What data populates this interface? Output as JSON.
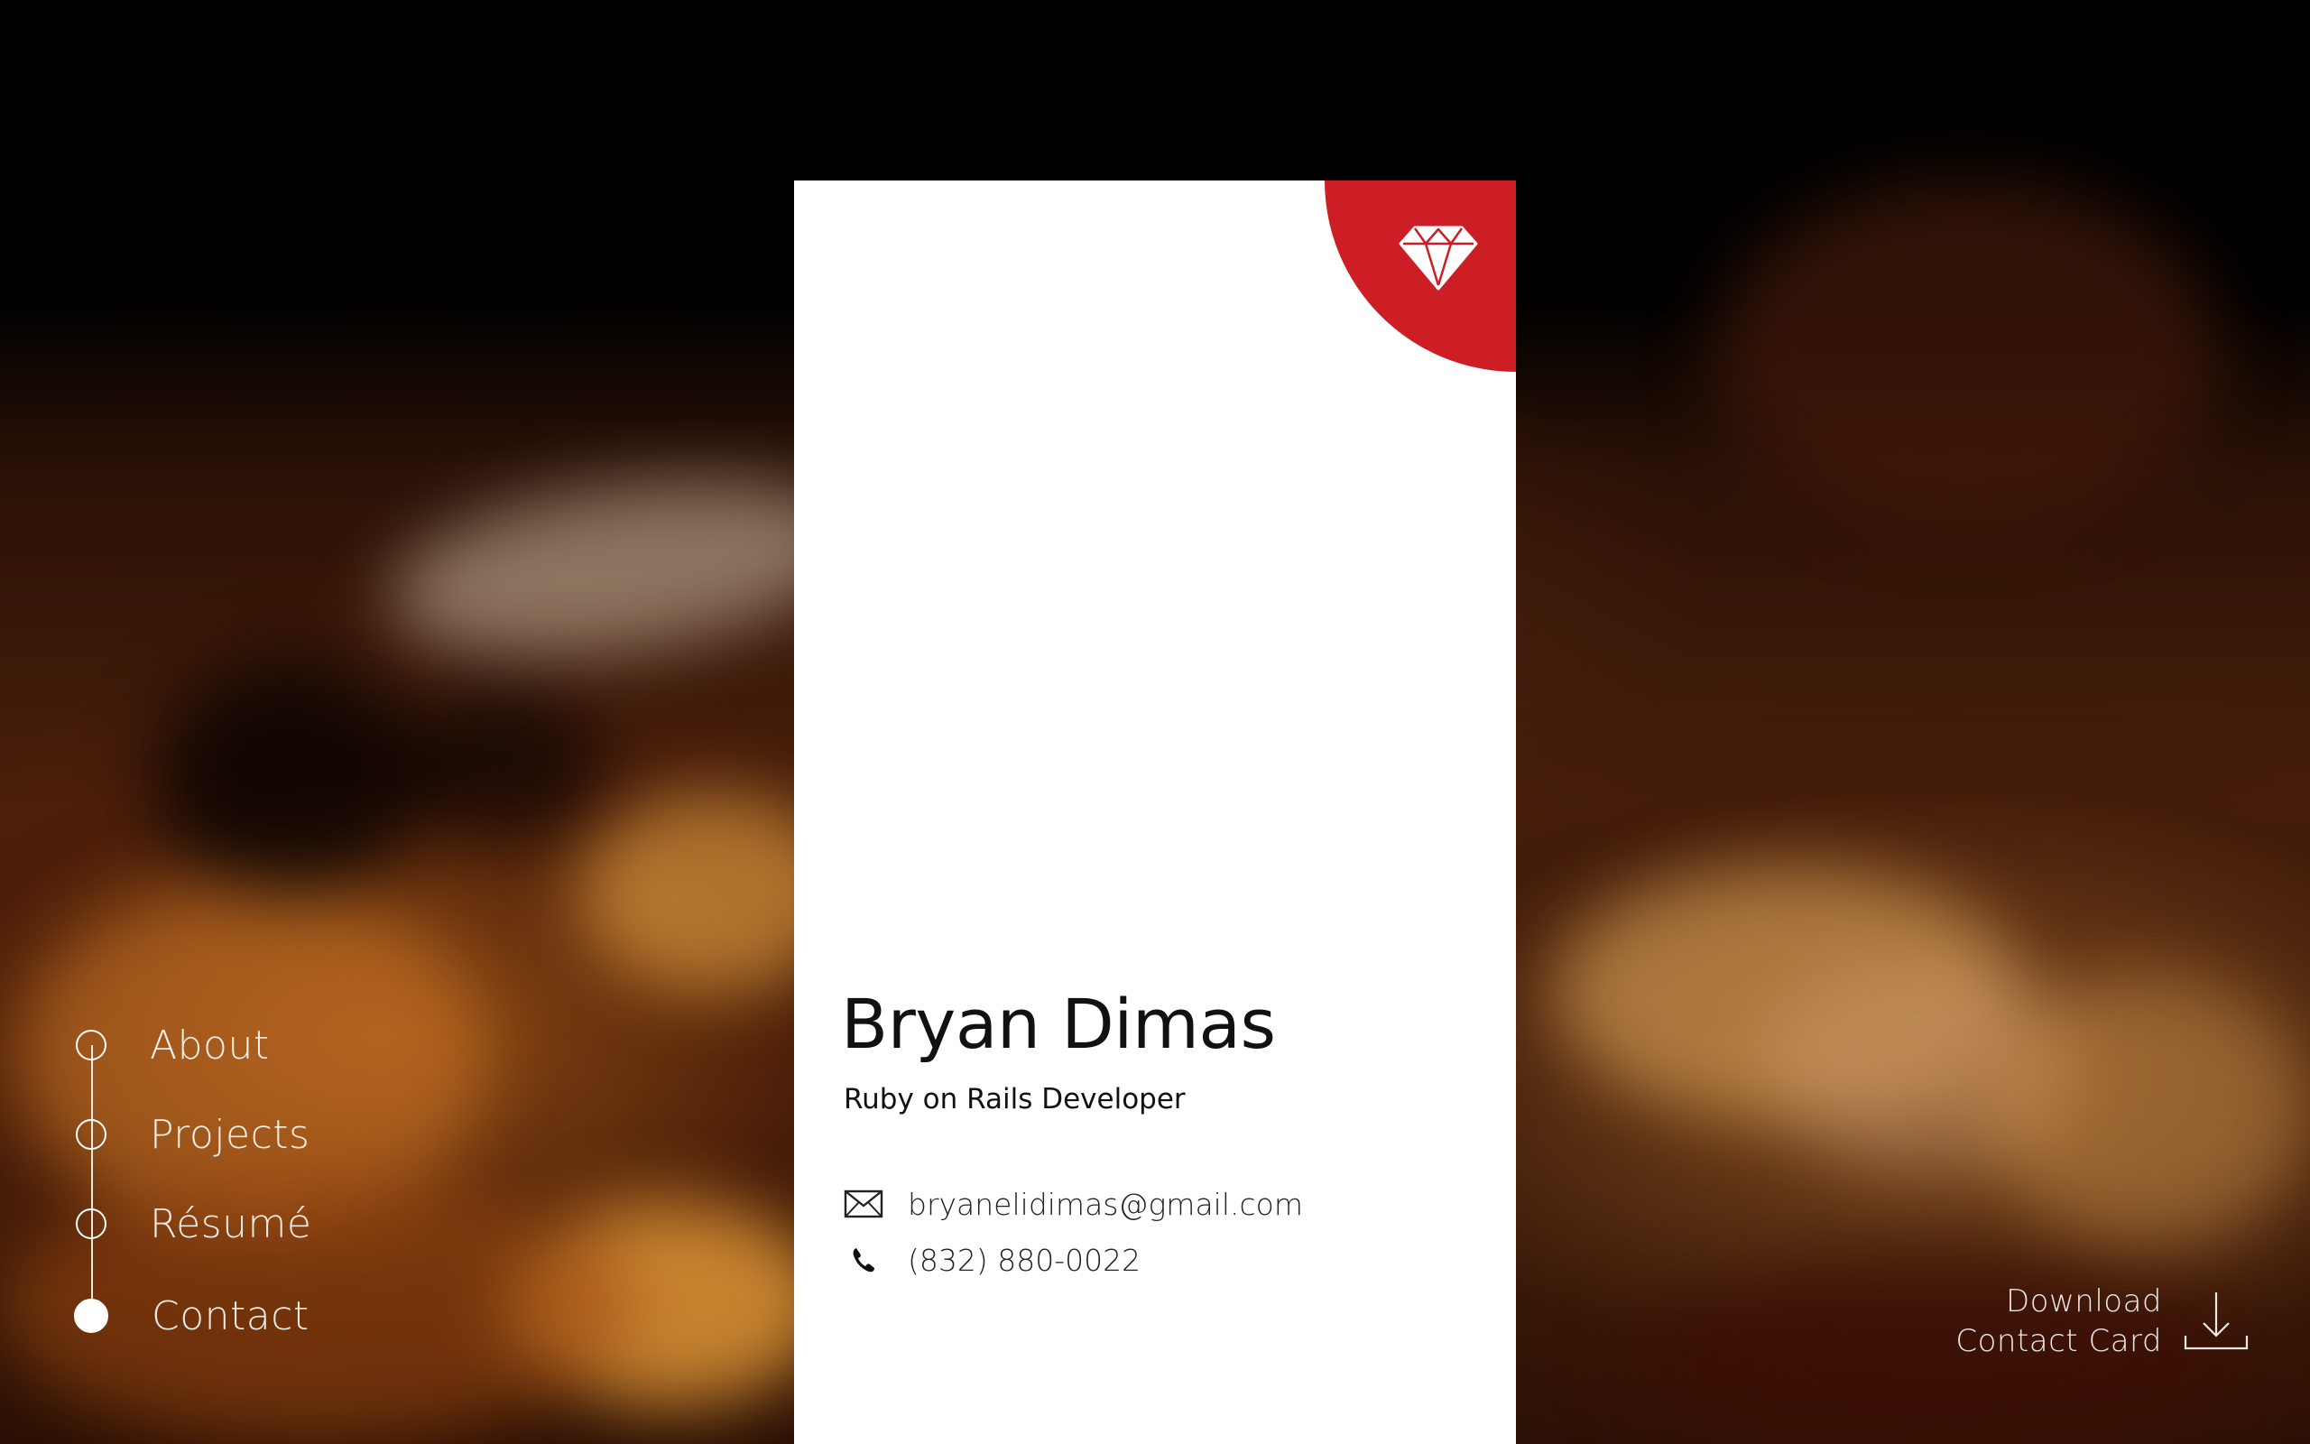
{
  "nav": {
    "items": [
      {
        "label": "About",
        "active": false
      },
      {
        "label": "Projects",
        "active": false
      },
      {
        "label": "Résumé",
        "active": false
      },
      {
        "label": "Contact",
        "active": true
      }
    ]
  },
  "card": {
    "name": "Bryan Dimas",
    "role": "Ruby on Rails Developer",
    "email": "bryanelidimas@gmail.com",
    "phone": "(832) 880-0022",
    "logo_icon": "ruby-gem-icon",
    "accent_color": "#cc1e24"
  },
  "download": {
    "line1": "Download",
    "line2": "Contact Card",
    "icon": "download-icon"
  }
}
